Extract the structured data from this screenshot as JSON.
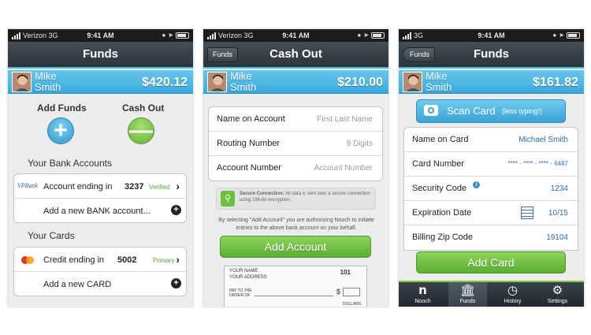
{
  "screen1": {
    "status": {
      "carrier": "Verizon 3G",
      "time": "9:41 AM"
    },
    "title": "Funds",
    "user": {
      "first": "Mike",
      "last": "Smith",
      "balance": "$420.12"
    },
    "add_funds": "Add Funds",
    "cash_out": "Cash Out",
    "bank_section": "Your Bank Accounts",
    "bank_account": {
      "label": "Account ending in",
      "number": "3237",
      "status": "Verified",
      "bank_logo": "VPBank"
    },
    "add_bank": "Add a new BANK account...",
    "cards_section": "Your Cards",
    "credit": {
      "label": "Credit ending in",
      "number": "5002",
      "status": "Primary"
    },
    "add_card": "Add a new CARD"
  },
  "screen2": {
    "status": {
      "carrier": "Verizon 3G",
      "time": "9:41 AM"
    },
    "back": "Funds",
    "title": "Cash Out",
    "user": {
      "first": "Mike",
      "last": "Smith",
      "balance": "$210.00"
    },
    "fields": [
      {
        "label": "Name on Account",
        "placeholder": "First Last Name"
      },
      {
        "label": "Routing Number",
        "placeholder": "9 Digits"
      },
      {
        "label": "Account Number",
        "placeholder": "Account Number"
      }
    ],
    "secure_title": "Secure Connection:",
    "secure_text": "All data is sent over a secure connection using 196-bit encryption.",
    "legal": "By selecting \"Add Account\" you are authorizing Nooch to initiate entries to the above bank account on your behalf.",
    "add_account": "Add Account",
    "check": {
      "name": "YOUR NAME",
      "address": "YOUR ADDRESS",
      "number": "101",
      "pay_to": "PAY TO THE ORDER OF",
      "dollar": "$",
      "dollars": "DOLLARS"
    }
  },
  "screen3": {
    "status": {
      "carrier": "3G",
      "time": "9:41 AM"
    },
    "back": "Funds",
    "title": "Funds",
    "user": {
      "first": "Mike",
      "last": "Smith",
      "balance": "$161.82"
    },
    "scan": "Scan Card",
    "scan_hint": "(less typing!)",
    "fields": [
      {
        "label": "Name on Card",
        "value": "Michael Smith"
      },
      {
        "label": "Card Number",
        "value": "**** - **** - **** - 6487"
      },
      {
        "label": "Security Code",
        "value": "1234"
      },
      {
        "label": "Expiration Date",
        "value": "10/15"
      },
      {
        "label": "Billing Zip Code",
        "value": "19104"
      }
    ],
    "add_card": "Add Card",
    "tabs": [
      "Nooch",
      "Funds",
      "History",
      "Settings"
    ]
  },
  "colors": {
    "accent": "#3ac1e6",
    "green": "#6cbf3f",
    "user_bar": "#4bb6e3",
    "nav": "#353c42"
  }
}
